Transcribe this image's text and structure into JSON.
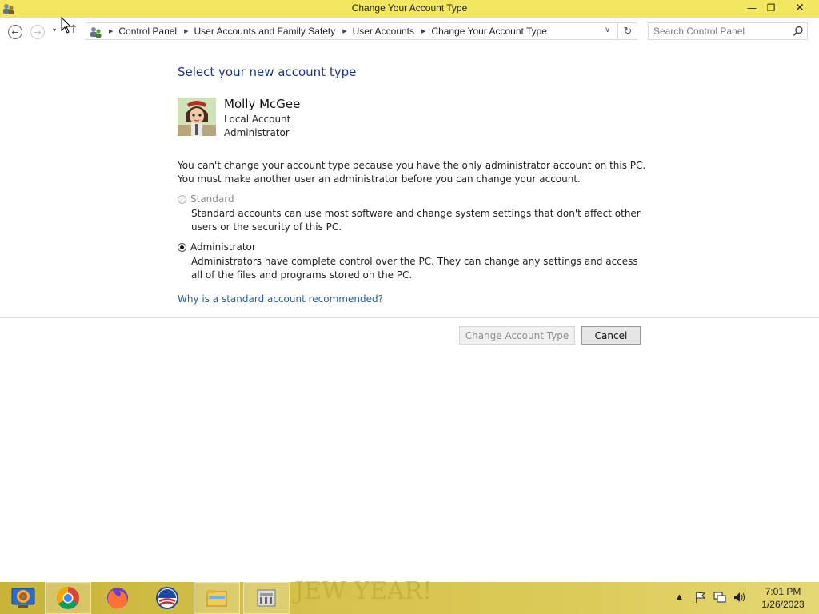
{
  "window": {
    "title": "Change Your Account Type",
    "minimize_symbol": "—",
    "maximize_symbol": "❐",
    "close_symbol": "✕"
  },
  "navigation": {
    "back_symbol": "←",
    "forward_symbol": "→",
    "recent_symbol": "▾",
    "up_symbol": "↑",
    "breadcrumb": [
      "Control Panel",
      "User Accounts and Family Safety",
      "User Accounts",
      "Change Your Account Type"
    ],
    "breadcrumb_separator": "▶",
    "dropdown_symbol": "∨",
    "refresh_symbol": "↻",
    "search_placeholder": "Search Control Panel"
  },
  "content": {
    "heading": "Select your new account type",
    "user": {
      "name": "Molly McGee",
      "account_type": "Local Account",
      "role": "Administrator"
    },
    "message": "You can't change your account type because you have the only administrator account on this PC. You must make another user an administrator before you can change your account.",
    "options": [
      {
        "label": "Standard",
        "description": "Standard accounts can use most software and change system settings that don't affect other users or the security of this PC.",
        "selected": false,
        "enabled": false
      },
      {
        "label": "Administrator",
        "description": "Administrators have complete control over the PC. They can change any settings and access all of the files and programs stored on the PC.",
        "selected": true,
        "enabled": true
      }
    ],
    "help_link": "Why is a standard account recommended?",
    "buttons": {
      "change": "Change Account Type",
      "cancel": "Cancel"
    }
  },
  "taskbar": {
    "background_text": "JEW YEAR!",
    "apps": [
      "remote-desktop-icon",
      "chrome-icon",
      "firefox-icon",
      "obama-logo-icon",
      "file-explorer-icon",
      "control-panel-icon"
    ],
    "tray_overflow_symbol": "▲",
    "clock": {
      "time": "7:01 PM",
      "date": "1/26/2023"
    }
  },
  "colors": {
    "titlebar": "#f3e661",
    "heading": "#1e3287",
    "link": "#1f5fa8",
    "taskbar": "#d6c24c"
  }
}
